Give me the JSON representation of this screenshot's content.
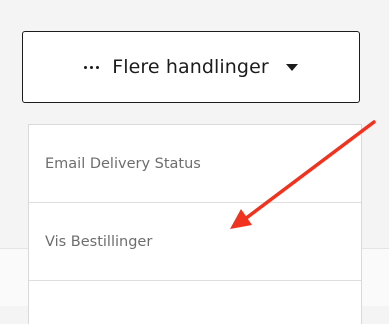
{
  "toolbar": {
    "more_actions_label": "Flere handlinger",
    "more_actions_icon": "ellipsis-icon",
    "dropdown_icon": "caret-down-icon"
  },
  "menu": {
    "items": [
      {
        "label": "Email Delivery Status"
      },
      {
        "label": "Vis Bestillinger"
      }
    ]
  },
  "annotation": {
    "arrow_color": "#f0321e"
  }
}
